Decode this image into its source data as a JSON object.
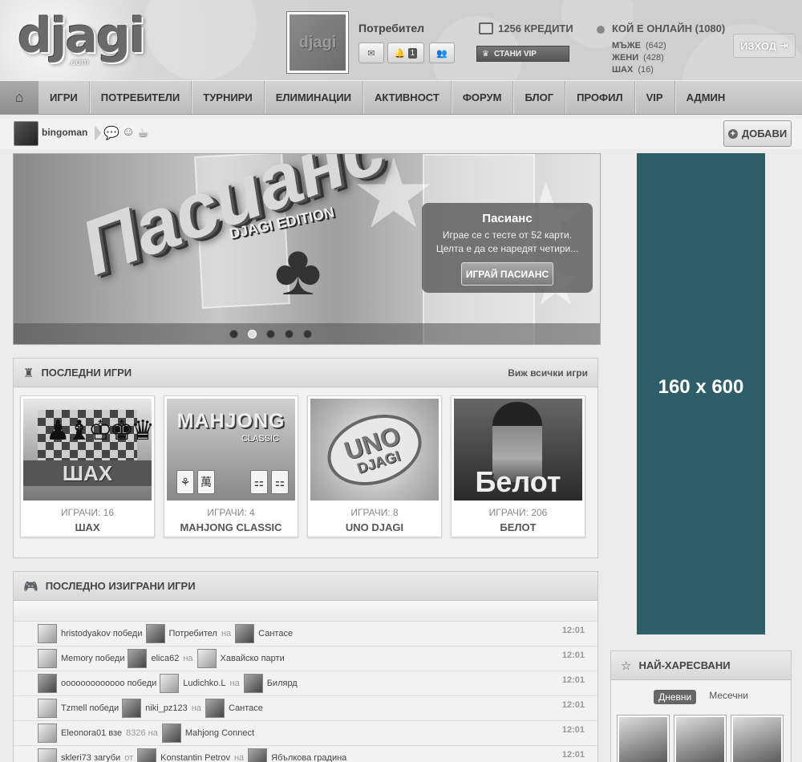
{
  "header": {
    "logo": "djagi",
    "logo_sub": ".com",
    "thumb_logo": "djagi",
    "user_label": "Потребител",
    "notifications_count": "1",
    "credits": "1256 КРЕДИТИ",
    "vip_button": "СТАНИ VIP",
    "online_title": "КОЙ Е ОНЛАЙН (1080)",
    "online_rows": [
      {
        "label": "МЪЖЕ",
        "count": "(642)"
      },
      {
        "label": "ЖЕНИ",
        "count": "(428)"
      },
      {
        "label": "ШАХ",
        "count": "(16)"
      }
    ],
    "exit_button": "ИЗХОД"
  },
  "nav": {
    "items": [
      "ИГРИ",
      "ПОТРЕБИТЕЛИ",
      "ТУРНИРИ",
      "ЕЛИМИНАЦИИ",
      "АКТИВНОСТ",
      "ФОРУМ",
      "БЛОГ",
      "ПРОФИЛ",
      "VIP",
      "АДМИН"
    ]
  },
  "status": {
    "username": "bingoman",
    "add_button": "ДОБАВИ"
  },
  "hero": {
    "title": "Пасианс",
    "edition": "DJAGI EDITION",
    "info_title": "Пасианс",
    "info_line1": "Играе се с тесте от 52 карти.",
    "info_line2": "Целта е да се наредят четири...",
    "play_button": "ИГРАЙ ПАСИАНС",
    "dots": 5,
    "active_dot": 1
  },
  "ad": {
    "label": "160 x 600"
  },
  "latest_games": {
    "title": "ПОСЛЕДНИ ИГРИ",
    "view_all": "Виж всички игри",
    "games": [
      {
        "name": "ШАХ",
        "players": "ИГРАЧИ: 16",
        "img_text": "ШАХ"
      },
      {
        "name": "MAHJONG CLASSIC",
        "players": "ИГРАЧИ: 4",
        "img_text": "MAHJONG",
        "img_sub": "CLASSIC"
      },
      {
        "name": "UNO DJAGI",
        "players": "ИГРАЧИ: 8",
        "img_text": "UNO",
        "img_sub": "DJAGI"
      },
      {
        "name": "БЕЛОТ",
        "players": "ИГРАЧИ: 206",
        "img_text": "Белот"
      }
    ]
  },
  "recent_played": {
    "title": "ПОСЛЕДНО ИЗИГРАНИ ИГРИ",
    "rows": [
      {
        "text": "hristodyakov победи",
        "opponent": "Потребител",
        "on": "на",
        "game": "Сантасе",
        "time": "12:01"
      },
      {
        "text": "Memory победи",
        "opponent": "elica62",
        "on": "на",
        "game": "Хавайско парти",
        "time": "12:01"
      },
      {
        "text": "ooooooooooooo победи",
        "opponent": "Ludichko.L",
        "on": "на",
        "game": "Билярд",
        "time": "12:01"
      },
      {
        "text": "Tzmell победи",
        "opponent": "niki_pz123",
        "on": "на",
        "game": "Сантасе",
        "time": "12:01"
      },
      {
        "text": "Eleonora01 взе",
        "opponent": "",
        "on": "8326 на",
        "game": "Mahjong Connect",
        "time": "12:01"
      },
      {
        "text": "skleri73 загуби",
        "opponent": "Konstantin Petrov",
        "on": "от",
        "on2": "на",
        "game": "Ябълкова градина",
        "time": "12:01"
      }
    ]
  },
  "most_liked": {
    "title": "НАЙ-ХАРЕСВАНИ",
    "tab_daily": "Дневни",
    "tab_monthly": "Месечни"
  }
}
